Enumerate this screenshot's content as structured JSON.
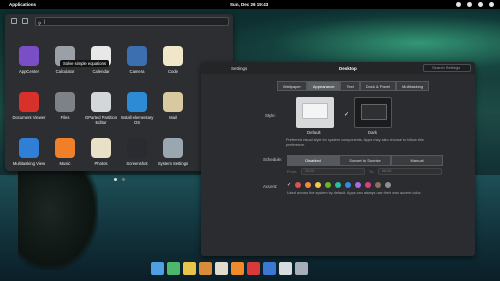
{
  "panel": {
    "applications": "Applications",
    "clock": "Sun, Dec 26     19:43"
  },
  "app_menu": {
    "search_value": "|",
    "tooltip": "Solve simple equations",
    "apps": [
      {
        "label": "AppCenter",
        "color": "#7a4fc6"
      },
      {
        "label": "Calculator",
        "color": "#9aa0a6"
      },
      {
        "label": "Calendar",
        "color": "#e8e8e8"
      },
      {
        "label": "Camera",
        "color": "#3b6fb0"
      },
      {
        "label": "Code",
        "color": "#f0e6c8"
      },
      {
        "label": "",
        "color": "transparent"
      },
      {
        "label": "Document Viewer",
        "color": "#d8312b"
      },
      {
        "label": "Files",
        "color": "#7d8289"
      },
      {
        "label": "GParted Partition Editor",
        "color": "#d4d7da"
      },
      {
        "label": "Install elementary OS",
        "color": "#2d8bd6"
      },
      {
        "label": "Mail",
        "color": "#d9c9a0"
      },
      {
        "label": "",
        "color": "transparent"
      },
      {
        "label": "Multitasking View",
        "color": "#2f7fd6"
      },
      {
        "label": "Music",
        "color": "#f07f2a"
      },
      {
        "label": "Photos",
        "color": "#e9e1c7"
      },
      {
        "label": "Screenshot",
        "color": "#2a2b30"
      },
      {
        "label": "System Settings",
        "color": "#9aa6b0"
      },
      {
        "label": "",
        "color": "transparent"
      }
    ]
  },
  "settings": {
    "back": "Settings",
    "title": "Desktop",
    "search_placeholder": "Search Settings",
    "tabs": [
      "Wallpaper",
      "Appearance",
      "Text",
      "Dock & Panel",
      "Multitasking"
    ],
    "style_label": "Style:",
    "style_default": "Default",
    "style_dark": "Dark",
    "style_desc": "Preferred visual style for system components. Apps may also choose to follow this preference.",
    "schedule_label": "Schedule:",
    "schedule_options": [
      "Disabled",
      "Sunset to Sunrise",
      "Manual"
    ],
    "from_label": "From:",
    "from_value": "20:00",
    "to_label": "To:",
    "to_value": "06:00",
    "accent_label": "Accent:",
    "accent_desc": "Used across the system by default. Apps can always use their own accent color.",
    "accent_colors": [
      "#e24f4f",
      "#f08a3c",
      "#f2c94c",
      "#68b723",
      "#28bca3",
      "#3689e6",
      "#a56de2",
      "#de3e80",
      "#8a715e",
      "#8d9091"
    ]
  },
  "dock_colors": [
    "#4ea0e0",
    "#4db86b",
    "#e8c54a",
    "#d98b3a",
    "#e0dccf",
    "#f08a2a",
    "#d83a3a",
    "#3b78d4",
    "#d9dcdf",
    "#a7b0ba"
  ]
}
